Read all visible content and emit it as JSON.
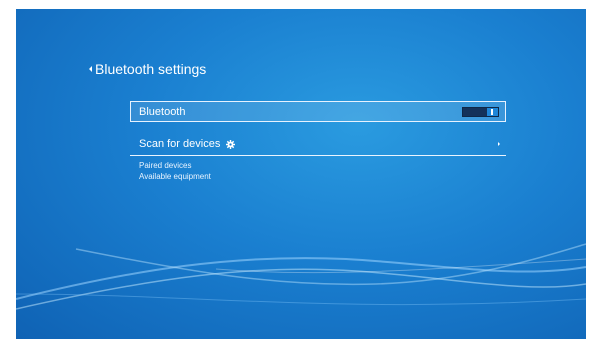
{
  "header": {
    "title": "Bluetooth settings",
    "back_icon": "chevron-left-icon"
  },
  "bluetooth": {
    "label": "Bluetooth",
    "state": "on"
  },
  "scan": {
    "label": "Scan for devices",
    "icon": "gear-icon",
    "arrow_icon": "chevron-right-icon"
  },
  "lists": {
    "paired": "Paired devices",
    "available": "Available equipment"
  },
  "colors": {
    "background": "#1a7fd0",
    "toggle_track": "#14325a",
    "toggle_on": "#1e86d8"
  }
}
